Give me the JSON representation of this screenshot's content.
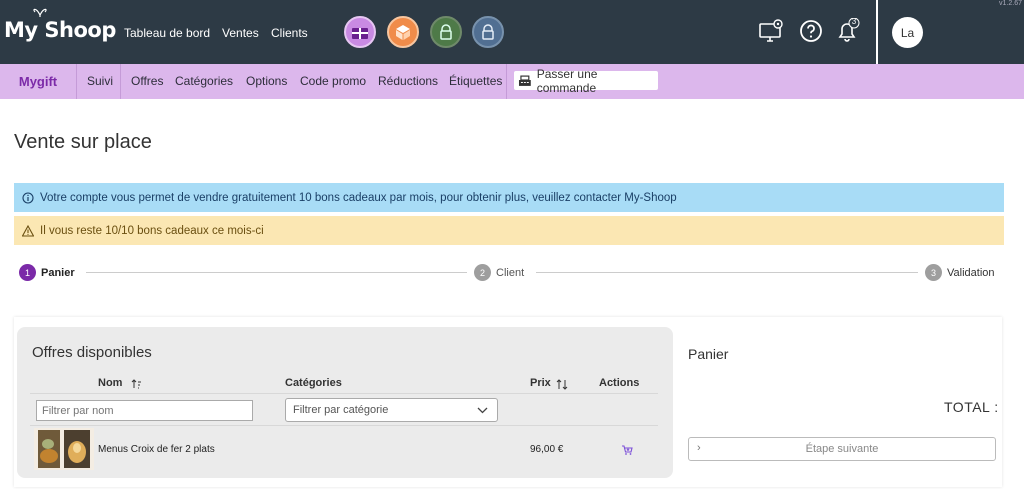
{
  "topbar": {
    "logo": "My Shoop",
    "version": "v1.2.67",
    "nav": [
      "Tableau de bord",
      "Ventes",
      "Clients"
    ],
    "apps": [
      {
        "name": "gift-app-icon",
        "color": "#c98ae3"
      },
      {
        "name": "box-app-icon",
        "color": "#f08c4a"
      },
      {
        "name": "lock-app-icon",
        "color": "#5a8d4f"
      },
      {
        "name": "lock-app-icon-2",
        "color": "#5b7fa6"
      }
    ],
    "notifications_count": "3",
    "avatar": "La"
  },
  "subnav": {
    "brand": "Mygift",
    "items": [
      "Suivi",
      "Offres",
      "Catégories",
      "Options",
      "Code promo",
      "Réductions",
      "Étiquettes"
    ],
    "order_button": "Passer une commande"
  },
  "page": {
    "title": "Vente sur place",
    "info_alert": "Votre compte vous permet de vendre gratuitement 10 bons cadeaux par mois, pour obtenir plus, veuillez contacter My-Shoop",
    "warn_alert": "Il vous reste 10/10 bons cadeaux ce mois-ci"
  },
  "stepper": {
    "steps": [
      {
        "num": "1",
        "label": "Panier"
      },
      {
        "num": "2",
        "label": "Client"
      },
      {
        "num": "3",
        "label": "Validation"
      }
    ],
    "active_color": "#7b2aa8",
    "inactive_color": "#9e9e9e"
  },
  "offers": {
    "title": "Offres disponibles",
    "columns": {
      "name": "Nom",
      "categories": "Catégories",
      "price": "Prix",
      "actions": "Actions"
    },
    "filter_name_placeholder": "Filtrer par nom",
    "filter_category_placeholder": "Filtrer par catégorie",
    "rows": [
      {
        "name": "Menus Croix de fer 2 plats",
        "price": "96,00 €"
      }
    ]
  },
  "cart": {
    "title": "Panier",
    "total_label": "TOTAL :",
    "next_button": "Étape suivante"
  }
}
